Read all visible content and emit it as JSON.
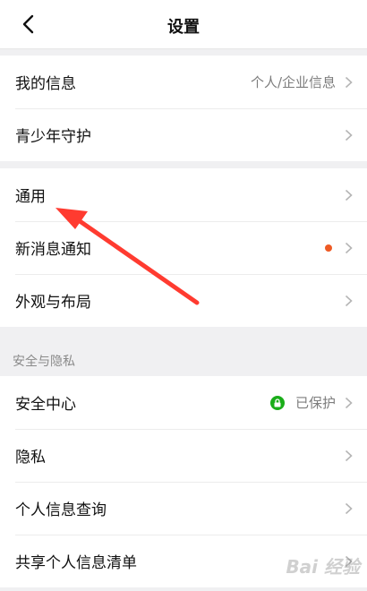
{
  "header": {
    "title": "设置"
  },
  "groups": [
    {
      "items": [
        {
          "label": "我的信息",
          "value": "个人/企业信息"
        },
        {
          "label": "青少年守护",
          "value": ""
        }
      ]
    },
    {
      "items": [
        {
          "label": "通用",
          "value": ""
        },
        {
          "label": "新消息通知",
          "value": "",
          "badge": "red-dot"
        },
        {
          "label": "外观与布局",
          "value": ""
        }
      ]
    },
    {
      "section_title": "安全与隐私",
      "items": [
        {
          "label": "安全中心",
          "value": "已保护",
          "icon": "lock-icon"
        },
        {
          "label": "隐私",
          "value": ""
        },
        {
          "label": "个人信息查询",
          "value": ""
        },
        {
          "label": "共享个人信息清单",
          "value": ""
        }
      ]
    }
  ],
  "watermark": "Bai 经验",
  "colors": {
    "accent_dot": "#ee5a24",
    "protected_green": "#1aad19",
    "annotation_red": "#ff3b30"
  }
}
